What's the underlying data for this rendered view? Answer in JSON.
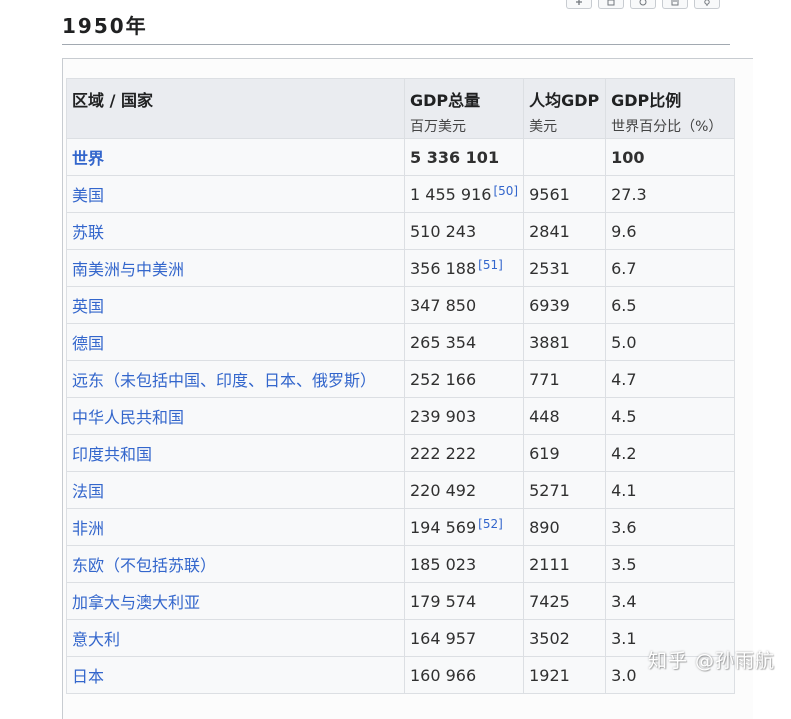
{
  "heading": "1950年",
  "table": {
    "columns": [
      {
        "label": "区域 / 国家",
        "sub": ""
      },
      {
        "label": "GDP总量",
        "sub": "百万美元"
      },
      {
        "label": "人均GDP",
        "sub": "美元"
      },
      {
        "label": "GDP比例",
        "sub": "世界百分比（%）"
      }
    ],
    "rows": [
      {
        "region": "世界",
        "gdp": "5 336 101",
        "ref": "",
        "per_capita": "",
        "share": "100"
      },
      {
        "region": "美国",
        "gdp": "1 455 916",
        "ref": "[50]",
        "per_capita": "9561",
        "share": "27.3"
      },
      {
        "region": "苏联",
        "gdp": "510 243",
        "ref": "",
        "per_capita": "2841",
        "share": "9.6"
      },
      {
        "region": "南美洲与中美洲",
        "gdp": "356 188",
        "ref": "[51]",
        "per_capita": "2531",
        "share": "6.7"
      },
      {
        "region": "英国",
        "gdp": "347 850",
        "ref": "",
        "per_capita": "6939",
        "share": "6.5"
      },
      {
        "region": "德国",
        "gdp": "265 354",
        "ref": "",
        "per_capita": "3881",
        "share": "5.0"
      },
      {
        "region": "远东（未包括中国、印度、日本、俄罗斯）",
        "gdp": "252 166",
        "ref": "",
        "per_capita": "771",
        "share": "4.7"
      },
      {
        "region": "中华人民共和国",
        "gdp": "239 903",
        "ref": "",
        "per_capita": "448",
        "share": "4.5"
      },
      {
        "region": "印度共和国",
        "gdp": "222 222",
        "ref": "",
        "per_capita": "619",
        "share": "4.2"
      },
      {
        "region": "法国",
        "gdp": "220 492",
        "ref": "",
        "per_capita": "5271",
        "share": "4.1"
      },
      {
        "region": "非洲",
        "gdp": "194 569",
        "ref": "[52]",
        "per_capita": "890",
        "share": "3.6"
      },
      {
        "region": "东欧（不包括苏联）",
        "gdp": "185 023",
        "ref": "",
        "per_capita": "2111",
        "share": "3.5"
      },
      {
        "region": "加拿大与澳大利亚",
        "gdp": "179 574",
        "ref": "",
        "per_capita": "7425",
        "share": "3.4"
      },
      {
        "region": "意大利",
        "gdp": "164 957",
        "ref": "",
        "per_capita": "3502",
        "share": "3.1"
      },
      {
        "region": "日本",
        "gdp": "160 966",
        "ref": "",
        "per_capita": "1921",
        "share": "3.0"
      }
    ]
  },
  "watermark": "知乎 @孙雨航",
  "colors": {
    "link": "#3366cc",
    "header_bg": "#eaecf0",
    "cell_bg": "#f8f9fa",
    "border": "#c8ccd1"
  },
  "icons": [
    "add-icon",
    "expand-icon",
    "history-icon",
    "page-icon",
    "settings-icon"
  ]
}
